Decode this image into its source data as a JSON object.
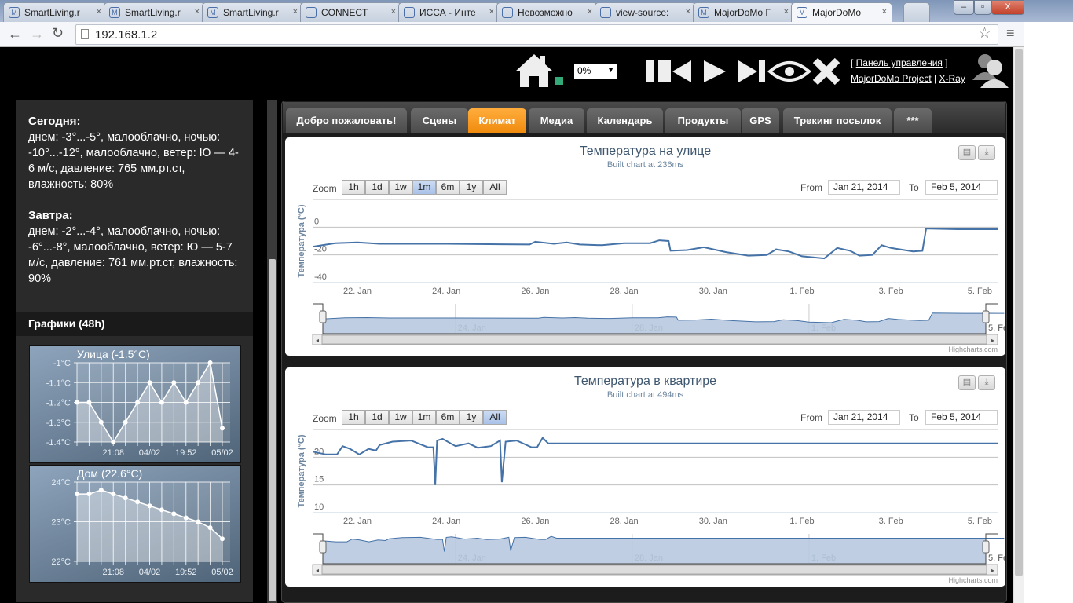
{
  "browser": {
    "tabs": [
      {
        "label": "SmartLiving.r",
        "icon": "majordomo-icon"
      },
      {
        "label": "SmartLiving.r",
        "icon": "majordomo-icon"
      },
      {
        "label": "SmartLiving.r",
        "icon": "majordomo-icon"
      },
      {
        "label": "CONNECT",
        "icon": "page-icon"
      },
      {
        "label": "ИССА - Инте",
        "icon": "issa-icon"
      },
      {
        "label": "Невозможно",
        "icon": "opera-icon"
      },
      {
        "label": "view-source:",
        "icon": "opera-icon"
      },
      {
        "label": "MajorDoMo Г",
        "icon": "majordomo-icon"
      },
      {
        "label": "MajorDoMo",
        "icon": "majordomo-icon",
        "active": true
      }
    ],
    "url": "192.168.1.2"
  },
  "header": {
    "volume": "0%",
    "control_panel": "Панель управления",
    "project_link": "MajorDoMo Project",
    "xray_link": "X-Ray",
    "icons": [
      "home-icon",
      "pause-icon",
      "previous-icon",
      "play-icon",
      "next-icon",
      "eye-icon",
      "close-icon",
      "users-icon"
    ]
  },
  "sidebar": {
    "today_title": "Сегодня:",
    "today_text": "днем: -3°...-5°, малооблачно, ночью: -10°...-12°, малооблачно, ветер: Ю — 4-6 м/с, давление: 765 мм.рт.ст, влажность: 80%",
    "tomorrow_title": "Завтра:",
    "tomorrow_text": "днем: -2°...-4°, малооблачно, ночью: -6°...-8°, малооблачно, ветер: Ю — 5-7 м/с, давление: 761 мм.рт.ст, влажность: 90%",
    "graphs_title": "Графики (48h)"
  },
  "tabs": [
    "Добро пожаловать!",
    "Сцены",
    "Климат",
    "Медиа",
    "Календарь",
    "Продукты",
    "GPS",
    "Трекинг посылок",
    "***"
  ],
  "active_tab": "Климат",
  "colors": {
    "accent": "#f08a0c",
    "series": "#4572a7",
    "navigator_fill": "#b8c9df"
  },
  "chart_data": [
    {
      "type": "line",
      "title": "Улица (-1.5°C)",
      "x_labels": [
        "",
        "",
        "",
        "21:08",
        "",
        "",
        "04/02",
        "",
        "",
        "19:52",
        "",
        "",
        "05/02"
      ],
      "values": [
        -1.2,
        -1.2,
        -1.3,
        -1.4,
        -1.3,
        -1.2,
        -1.1,
        -1.2,
        -1.1,
        -1.2,
        -1.1,
        -1.0,
        -1.33
      ],
      "y_ticks": [
        "-1°C",
        "-1.1°C",
        "-1.2°C",
        "-1.3°C",
        "-1.4°C"
      ],
      "ylim": [
        -1.4,
        -1.0
      ],
      "grid": true
    },
    {
      "type": "line",
      "title": "Дом (22.6°C)",
      "x_labels": [
        "",
        "",
        "",
        "21:08",
        "",
        "",
        "04/02",
        "",
        "",
        "19:52",
        "",
        "",
        "05/02"
      ],
      "values": [
        23.7,
        23.7,
        23.8,
        23.7,
        23.6,
        23.5,
        23.4,
        23.3,
        23.2,
        23.1,
        23.0,
        22.85,
        22.57
      ],
      "y_ticks": [
        "24°C",
        "23°C",
        "22°C"
      ],
      "ylim": [
        22,
        24
      ],
      "grid": true
    },
    {
      "type": "line",
      "title": "Температура на улице",
      "subtitle": "Built chart at 236ms",
      "ylabel": "Температура (°C)",
      "ylim": [
        -40,
        20
      ],
      "y_ticks": [
        0,
        -20,
        -40
      ],
      "x_ticks": [
        "22. Jan",
        "24. Jan",
        "26. Jan",
        "28. Jan",
        "30. Jan",
        "1. Feb",
        "3. Feb",
        "5. Feb"
      ],
      "navigator_ticks": [
        "24. Jan",
        "28. Jan",
        "1. Feb",
        "5. Feb"
      ],
      "range_buttons": [
        "1h",
        "1d",
        "1w",
        "1m",
        "6m",
        "1y",
        "All"
      ],
      "selected_range": "1m",
      "from": "Jan 21, 2014",
      "to": "Feb 5, 2014",
      "credits": "Highcharts.com",
      "points": [
        [
          "2014-01-21T00:00",
          -14
        ],
        [
          "2014-01-21T12:00",
          -11.5
        ],
        [
          "2014-01-22T00:00",
          -11
        ],
        [
          "2014-01-22T12:00",
          -12
        ],
        [
          "2014-01-24T00:00",
          -12
        ],
        [
          "2014-01-25T21:00",
          -12.5
        ],
        [
          "2014-01-26T00:00",
          -10.5
        ],
        [
          "2014-01-26T10:00",
          -12
        ],
        [
          "2014-01-26T17:00",
          -11
        ],
        [
          "2014-01-27T00:00",
          -12.5
        ],
        [
          "2014-01-27T12:00",
          -13
        ],
        [
          "2014-01-28T00:00",
          -11.5
        ],
        [
          "2014-01-28T14:00",
          -11.5
        ],
        [
          "2014-01-28T19:00",
          -9.5
        ],
        [
          "2014-01-29T00:00",
          -10
        ],
        [
          "2014-01-29T01:00",
          -17
        ],
        [
          "2014-01-29T10:00",
          -16.5
        ],
        [
          "2014-01-29T19:00",
          -14.5
        ],
        [
          "2014-01-30T07:00",
          -18
        ],
        [
          "2014-01-30T19:00",
          -20.5
        ],
        [
          "2014-01-31T05:00",
          -20
        ],
        [
          "2014-01-31T10:00",
          -16
        ],
        [
          "2014-01-31T17:00",
          -17.5
        ],
        [
          "2014-02-01T00:00",
          -21
        ],
        [
          "2014-02-01T12:00",
          -22.5
        ],
        [
          "2014-02-01T19:00",
          -15
        ],
        [
          "2014-02-02T02:00",
          -17
        ],
        [
          "2014-02-02T07:00",
          -20.5
        ],
        [
          "2014-02-02T14:00",
          -20
        ],
        [
          "2014-02-02T19:00",
          -13
        ],
        [
          "2014-02-03T00:00",
          -15
        ],
        [
          "2014-02-03T12:00",
          -17.5
        ],
        [
          "2014-02-03T17:00",
          -17
        ],
        [
          "2014-02-03T19:00",
          -1
        ],
        [
          "2014-02-04T12:00",
          -1.5
        ],
        [
          "2014-02-05T10:00",
          -1.5
        ]
      ]
    },
    {
      "type": "line",
      "title": "Температура в квартире",
      "subtitle": "Built chart at 494ms",
      "ylabel": "Температура (°C)",
      "ylim": [
        10,
        25
      ],
      "y_ticks": [
        20,
        15,
        10
      ],
      "x_ticks": [
        "22. Jan",
        "24. Jan",
        "26. Jan",
        "28. Jan",
        "30. Jan",
        "1. Feb",
        "3. Feb",
        "5. Feb"
      ],
      "navigator_ticks": [
        "24. Jan",
        "28. Jan",
        "1. Feb",
        "5. Feb"
      ],
      "range_buttons": [
        "1h",
        "1d",
        "1w",
        "1m",
        "6m",
        "1y",
        "All"
      ],
      "selected_range": "All",
      "from": "Jan 21, 2014",
      "to": "Feb 5, 2014",
      "credits": "Highcharts.com",
      "points": [
        [
          "2014-01-21T00:00",
          21
        ],
        [
          "2014-01-21T07:00",
          20.5
        ],
        [
          "2014-01-21T13:00",
          20.5
        ],
        [
          "2014-01-21T16:00",
          22
        ],
        [
          "2014-01-21T20:00",
          21.5
        ],
        [
          "2014-01-22T01:00",
          20.5
        ],
        [
          "2014-01-22T06:00",
          21.5
        ],
        [
          "2014-01-22T10:00",
          21.2
        ],
        [
          "2014-01-22T12:00",
          22.2
        ],
        [
          "2014-01-22T19:00",
          22.8
        ],
        [
          "2014-01-23T05:00",
          23
        ],
        [
          "2014-01-23T14:00",
          21.8
        ],
        [
          "2014-01-23T17:00",
          21.8
        ],
        [
          "2014-01-23T18:00",
          15
        ],
        [
          "2014-01-23T19:00",
          23
        ],
        [
          "2014-01-23T22:00",
          23.3
        ],
        [
          "2014-01-24T05:00",
          22
        ],
        [
          "2014-01-24T12:00",
          22.5
        ],
        [
          "2014-01-24T17:00",
          21.7
        ],
        [
          "2014-01-25T00:00",
          22
        ],
        [
          "2014-01-25T05:00",
          23
        ],
        [
          "2014-01-25T06:00",
          15.5
        ],
        [
          "2014-01-25T08:00",
          22.8
        ],
        [
          "2014-01-25T14:00",
          23
        ],
        [
          "2014-01-25T22:00",
          21.8
        ],
        [
          "2014-01-26T01:00",
          21.8
        ],
        [
          "2014-01-26T04:00",
          23.5
        ],
        [
          "2014-01-26T07:00",
          22.5
        ],
        [
          "2014-01-26T12:00",
          22.5
        ],
        [
          "2014-02-05T10:00",
          22.5
        ]
      ]
    }
  ]
}
